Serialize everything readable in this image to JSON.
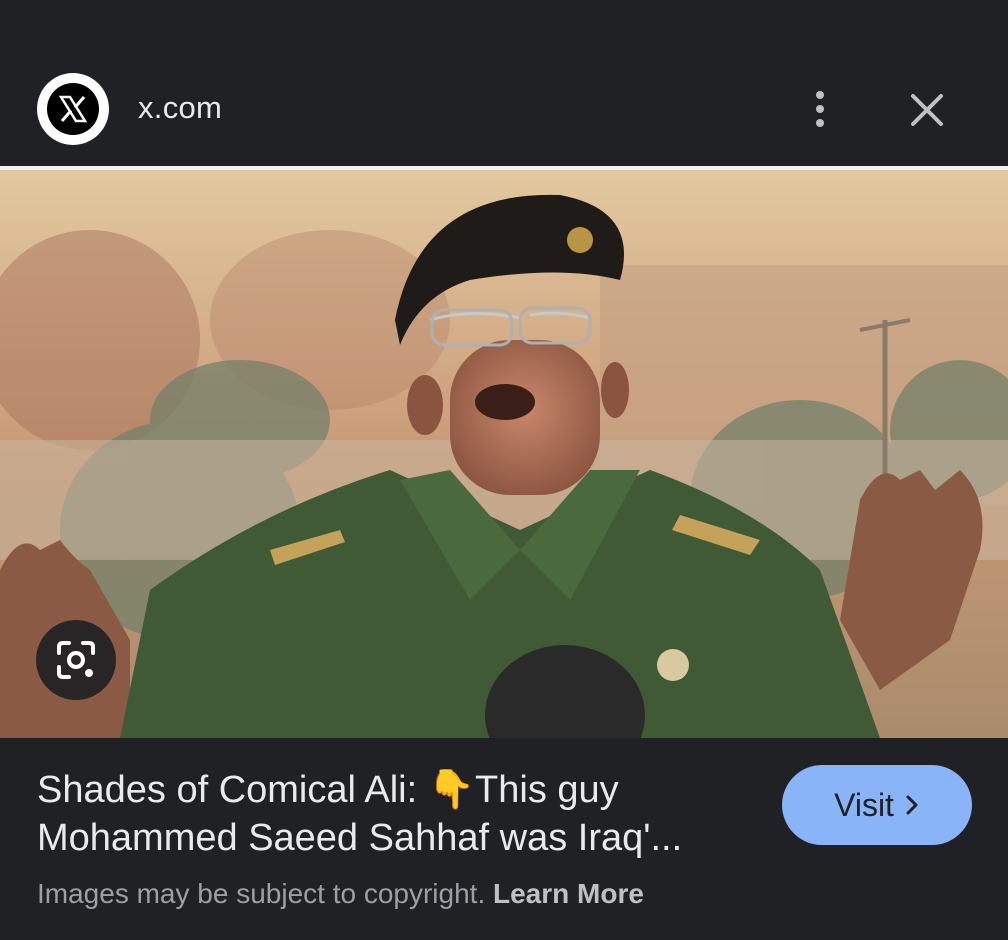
{
  "header": {
    "site_name": "x.com",
    "favicon_icon": "x-logo-icon",
    "more_icon": "more-vert-icon",
    "close_icon": "close-icon"
  },
  "image": {
    "lens_icon": "google-lens-icon"
  },
  "caption": {
    "title": "Shades of Comical Ali: 👇This guy\nMohammed Saeed Sahhaf was Iraq'..."
  },
  "actions": {
    "visit_label": "Visit",
    "visit_icon": "chevron-right-icon"
  },
  "footer": {
    "copyright_text": "Images may be subject to copyright.",
    "learn_more_label": "Learn More"
  },
  "colors": {
    "background": "#202124",
    "accent": "#8ab4f8",
    "text_primary": "#e8eaed",
    "text_secondary": "#9aa0a6"
  }
}
